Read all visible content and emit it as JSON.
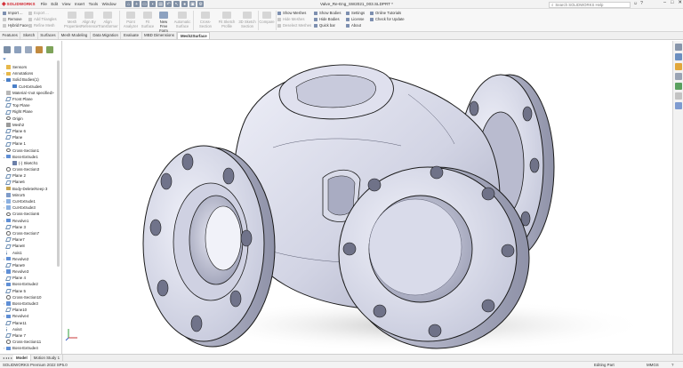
{
  "app": {
    "logo_text": "SOLIDWORKS",
    "menu": [
      "File",
      "Edit",
      "View",
      "Insert",
      "Tools",
      "Window"
    ],
    "doc_title": "Valve_Re-Eng_SW2021_003.SLDPRT *",
    "search_placeholder": "Search SOLIDWORKS Help",
    "window_buttons": [
      "–",
      "□",
      "✕"
    ]
  },
  "ribbon": {
    "col1": [
      "Import ...",
      "Remove",
      "Hybrid Faces"
    ],
    "col2": [
      "Export ...",
      "Add Triangles",
      "Refine Mesh"
    ],
    "col3": [
      "Mesh Properties",
      "Clean up",
      "Align by Reference"
    ],
    "big_buttons": [
      {
        "label": "Align By Reference",
        "dark": false
      },
      {
        "label": "Align Transformer",
        "dark": false
      },
      {
        "label": "Point Analyzer",
        "dark": false
      },
      {
        "label": "Fit Surface",
        "dark": false
      },
      {
        "label": "New Free Form",
        "dark": true
      },
      {
        "label": "Automatic Surface",
        "dark": false
      },
      {
        "label": "Cross-Section",
        "dark": false
      },
      {
        "label": "Fit Sketch Profile",
        "dark": false
      },
      {
        "label": "3D Sketch Section",
        "dark": false
      },
      {
        "label": "Compare",
        "dark": false
      }
    ],
    "show_col": [
      "Show Meshes",
      "Hide Meshes",
      "Deselect Meshes"
    ],
    "body_col": [
      "Show Bodies",
      "Hide Bodies",
      "Quick bar"
    ],
    "settings_col": [
      "Settings",
      "License",
      "About"
    ],
    "help_col": [
      "Online Tutorials",
      "Check for Update"
    ]
  },
  "tabs": [
    "Features",
    "Sketch",
    "Surfaces",
    "Mesh Modeling",
    "Data Migration",
    "Evaluate",
    "MBD Dimensions",
    "Mesh2Surface"
  ],
  "active_tab": "Mesh2Surface",
  "tree": [
    {
      "label": "Sensors",
      "icon": "folder",
      "exp": ""
    },
    {
      "label": "Annotations",
      "icon": "folder",
      "exp": "›"
    },
    {
      "label": "Solid Bodies(1)",
      "icon": "body",
      "exp": "⌄"
    },
    {
      "label": "Cut-Extrude6",
      "icon": "body",
      "exp": "",
      "indent": 1
    },
    {
      "label": "Material <not specified>",
      "icon": "material",
      "exp": ""
    },
    {
      "label": "Front Plane",
      "icon": "plane",
      "exp": ""
    },
    {
      "label": "Top Plane",
      "icon": "plane",
      "exp": ""
    },
    {
      "label": "Right Plane",
      "icon": "plane",
      "exp": ""
    },
    {
      "label": "Origin",
      "icon": "origin",
      "exp": ""
    },
    {
      "label": "Mesh2",
      "icon": "mesh",
      "exp": ""
    },
    {
      "label": "Plane 6",
      "icon": "plane",
      "exp": ""
    },
    {
      "label": "Plane",
      "icon": "plane",
      "exp": ""
    },
    {
      "label": "Plane 1",
      "icon": "plane",
      "exp": ""
    },
    {
      "label": "Cross-Section1",
      "icon": "section",
      "exp": ""
    },
    {
      "label": "Boss-Extrude1",
      "icon": "feature",
      "exp": "⌄"
    },
    {
      "label": "(-) Sketch1",
      "icon": "sketch",
      "exp": "",
      "indent": 1
    },
    {
      "label": "Cross-Section3",
      "icon": "section",
      "exp": ""
    },
    {
      "label": "Plane 2",
      "icon": "plane",
      "exp": ""
    },
    {
      "label": "Plane6",
      "icon": "plane",
      "exp": ""
    },
    {
      "label": "Body-Delete/Keep 3",
      "icon": "delete",
      "exp": ""
    },
    {
      "label": "Mirror5",
      "icon": "mirror",
      "exp": ""
    },
    {
      "label": "Cut-Extrude1",
      "icon": "cut",
      "exp": "›"
    },
    {
      "label": "Cut-Extrude3",
      "icon": "cut",
      "exp": "›"
    },
    {
      "label": "Cross-Section6",
      "icon": "section",
      "exp": ""
    },
    {
      "label": "Revolve1",
      "icon": "feature",
      "exp": "›"
    },
    {
      "label": "Plane 3",
      "icon": "plane",
      "exp": ""
    },
    {
      "label": "Cross-Section7",
      "icon": "section",
      "exp": ""
    },
    {
      "label": "Plane7",
      "icon": "plane",
      "exp": ""
    },
    {
      "label": "Plane8",
      "icon": "plane",
      "exp": ""
    },
    {
      "label": "Axis1",
      "icon": "axis",
      "exp": ""
    },
    {
      "label": "Revolve2",
      "icon": "feature",
      "exp": "›"
    },
    {
      "label": "Plane9",
      "icon": "plane",
      "exp": ""
    },
    {
      "label": "Revolve3",
      "icon": "feature",
      "exp": "›"
    },
    {
      "label": "Plane 4",
      "icon": "plane",
      "exp": ""
    },
    {
      "label": "Boss-Extrude2",
      "icon": "feature",
      "exp": "›"
    },
    {
      "label": "Plane 5",
      "icon": "plane",
      "exp": ""
    },
    {
      "label": "Cross-Section10",
      "icon": "section",
      "exp": ""
    },
    {
      "label": "Boss-Extrude3",
      "icon": "feature",
      "exp": "›"
    },
    {
      "label": "Plane10",
      "icon": "plane",
      "exp": ""
    },
    {
      "label": "Revolve4",
      "icon": "feature",
      "exp": "›"
    },
    {
      "label": "Plane11",
      "icon": "plane",
      "exp": ""
    },
    {
      "label": "Axis4",
      "icon": "axis",
      "exp": ""
    },
    {
      "label": "Plane 7",
      "icon": "plane",
      "exp": ""
    },
    {
      "label": "Cross-Section11",
      "icon": "section",
      "exp": ""
    },
    {
      "label": "Boss-Extrude4",
      "icon": "feature",
      "exp": "›"
    }
  ],
  "bottom_tabs": [
    "Model",
    "Motion Study 1"
  ],
  "status": {
    "left": "SOLIDWORKS Premium 2022 SP5.0",
    "mode": "Editing Part",
    "units": "MMGS",
    "help": "?"
  },
  "colors": {
    "brand": "#d0202a",
    "part_fill": "#d6d8e8",
    "part_edge": "#1a1a1a"
  }
}
